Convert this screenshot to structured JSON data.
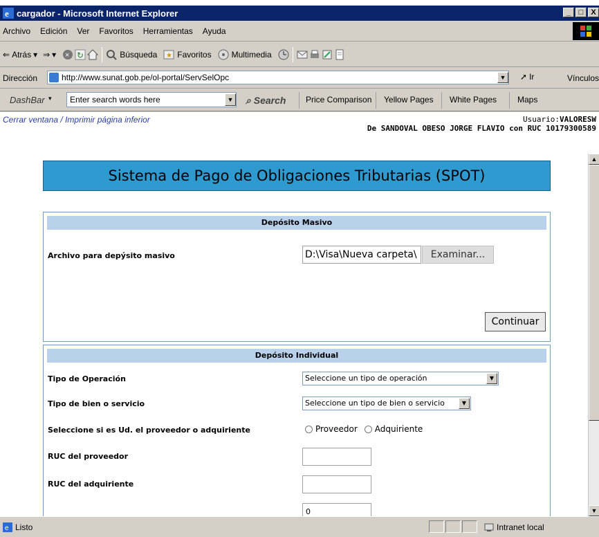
{
  "window": {
    "title": "cargador - Microsoft Internet Explorer",
    "min": "_",
    "max": "□",
    "close": "X"
  },
  "menu": [
    "Archivo",
    "Edición",
    "Ver",
    "Favoritos",
    "Herramientas",
    "Ayuda"
  ],
  "toolbar": {
    "back": "Atrás",
    "search": "Búsqueda",
    "favorites": "Favoritos",
    "media": "Multimedia"
  },
  "address": {
    "label": "Dirección",
    "url": "http://www.sunat.gob.pe/ol-portal/ServSelOpc",
    "go": "Ir",
    "links": "Vínculos"
  },
  "dashbar": {
    "brand": "DashBar",
    "search_placeholder": "Enter search words here",
    "search_button": "Search",
    "links": [
      "Price Comparison",
      "Yellow Pages",
      "White Pages",
      "Maps"
    ]
  },
  "page": {
    "close_window": "Cerrar ventana",
    "link_sep": "/",
    "print_lower": "Imprimir página inferior",
    "user_label": "Usuario:",
    "user_value": "VALORESW",
    "company_line": "De SANDOVAL OBESO JORGE FLAVIO con RUC 10179300589",
    "heading": "Sistema de Pago de Obligaciones Tributarias (SPOT)"
  },
  "masivo": {
    "header": "Depósito Masivo",
    "file_label": "Archivo para depýsito masivo",
    "file_value": "D:\\Visa\\Nueva carpeta\\",
    "browse": "Examinar...",
    "continue": "Continuar"
  },
  "individual": {
    "header": "Depósito Individual",
    "tipo_operacion_label": "Tipo de Operación",
    "tipo_operacion_value": "Seleccione un tipo de operación",
    "tipo_bien_label": "Tipo de bien o servicio",
    "tipo_bien_value": "Seleccione un tipo de bien o servicio",
    "rol_label": "Seleccione si es Ud. el proveedor o adquiriente",
    "rol_options": [
      "Proveedor",
      "Adquiriente"
    ],
    "ruc_proveedor_label": "RUC del proveedor",
    "ruc_adquiriente_label": "RUC del adquiriente",
    "monto_value": "0"
  },
  "status": {
    "text": "Listo",
    "zone": "Intranet local"
  }
}
